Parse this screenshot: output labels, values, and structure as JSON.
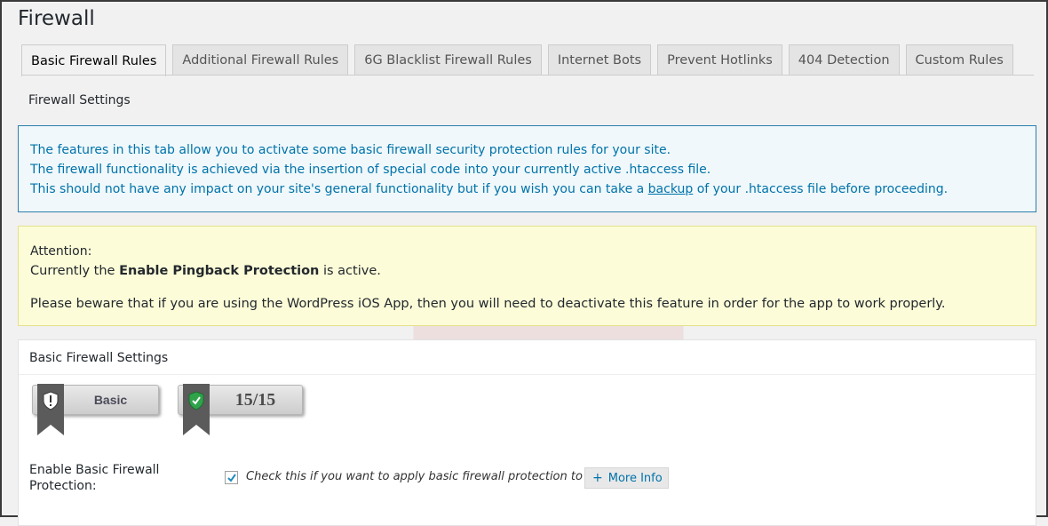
{
  "page": {
    "title": "Firewall"
  },
  "tabs": [
    {
      "label": "Basic Firewall Rules",
      "active": true
    },
    {
      "label": "Additional Firewall Rules",
      "active": false
    },
    {
      "label": "6G Blacklist Firewall Rules",
      "active": false
    },
    {
      "label": "Internet Bots",
      "active": false
    },
    {
      "label": "Prevent Hotlinks",
      "active": false
    },
    {
      "label": "404 Detection",
      "active": false
    },
    {
      "label": "Custom Rules",
      "active": false
    }
  ],
  "section": {
    "title": "Firewall Settings"
  },
  "info_box": {
    "line1": "The features in this tab allow you to activate some basic firewall security protection rules for your site.",
    "line2": "The firewall functionality is achieved via the insertion of special code into your currently active .htaccess file.",
    "line3_before": "This should not have any impact on your site's general functionality but if you wish you can take a ",
    "line3_link": "backup",
    "line3_after": " of your .htaccess file before proceeding.",
    "border_color": "#2a7fae",
    "text_color": "#0073aa"
  },
  "warning_box": {
    "heading": "Attention:",
    "line2_before": "Currently the ",
    "line2_bold": "Enable Pingback Protection",
    "line2_after": " is active.",
    "line3": "Please beware that if you are using the WordPress iOS App, then you will need to deactivate this feature in order for the app to work properly.",
    "background": "#fcfcd8"
  },
  "panel": {
    "title": "Basic Firewall Settings",
    "badges": [
      {
        "label": "Basic",
        "icon": "shield-exclamation-icon"
      },
      {
        "label": "15/15",
        "icon": "shield-check-icon"
      }
    ],
    "field": {
      "label": "Enable Basic Firewall Protection:",
      "checked": true,
      "description": "Check this if you want to apply basic firewall protection to your site.",
      "more_info": "More Info"
    }
  }
}
